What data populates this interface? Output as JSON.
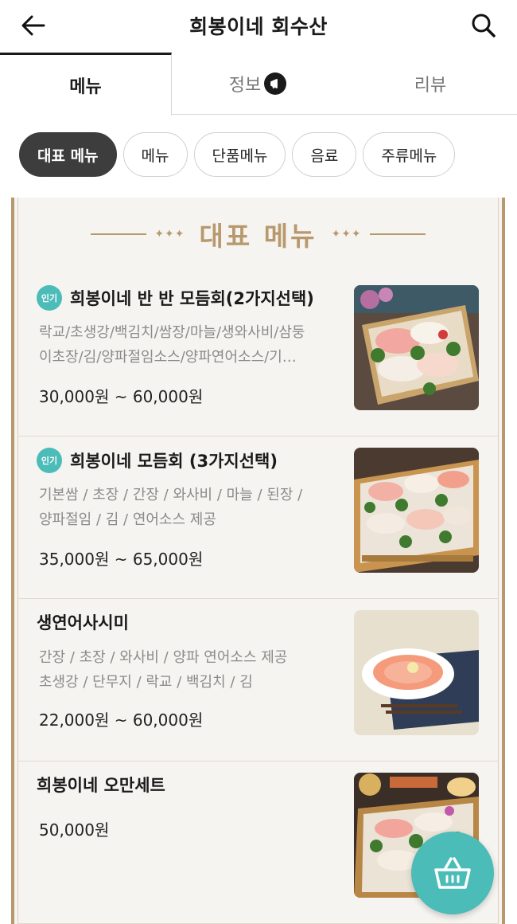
{
  "header": {
    "title": "희봉이네 회수산",
    "back_icon": "arrow-left-icon",
    "search_icon": "search-icon"
  },
  "tabs": [
    {
      "label": "메뉴",
      "active": true
    },
    {
      "label": "정보",
      "active": false,
      "badge_icon": "megaphone-icon"
    },
    {
      "label": "리뷰",
      "active": false
    }
  ],
  "categories": [
    {
      "label": "대표 메뉴",
      "active": true
    },
    {
      "label": "메뉴",
      "active": false
    },
    {
      "label": "단품메뉴",
      "active": false
    },
    {
      "label": "음료",
      "active": false
    },
    {
      "label": "주류메뉴",
      "active": false
    }
  ],
  "section": {
    "title": "대표 메뉴",
    "accent_color": "#b8996d"
  },
  "popular_badge": "인기",
  "items": [
    {
      "name": "희봉이네 반 반 모듬회(2가지선택)",
      "popular": true,
      "desc_line1": "락교/초생강/백김치/쌈장/마늘/생와사비/삼둥",
      "desc_line2": "이초장/김/양파절임소스/양파연어소스/기…",
      "price": "30,000원 ~ 60,000원"
    },
    {
      "name": "희봉이네 모듬회 (3가지선택)",
      "popular": true,
      "desc_line1": "기본쌈 / 초장 / 간장 / 와사비 / 마늘 / 된장 /",
      "desc_line2": "양파절임 / 김 / 연어소스 제공",
      "price": "35,000원 ~ 65,000원"
    },
    {
      "name": "생연어사시미",
      "popular": false,
      "desc_line1": "간장 / 초장 / 와사비 / 양파 연어소스 제공",
      "desc_line2": "초생강 / 단무지 / 락교 / 백김치 / 김",
      "price": "22,000원 ~ 60,000원"
    },
    {
      "name": "희봉이네 오만세트",
      "popular": false,
      "desc_line1": "",
      "desc_line2": "",
      "price": "50,000원"
    }
  ],
  "cart_icon": "shopping-basket-icon",
  "colors": {
    "brand": "#4bbcb8",
    "active_chip": "#3d3d3d",
    "gold": "#b8996d"
  }
}
